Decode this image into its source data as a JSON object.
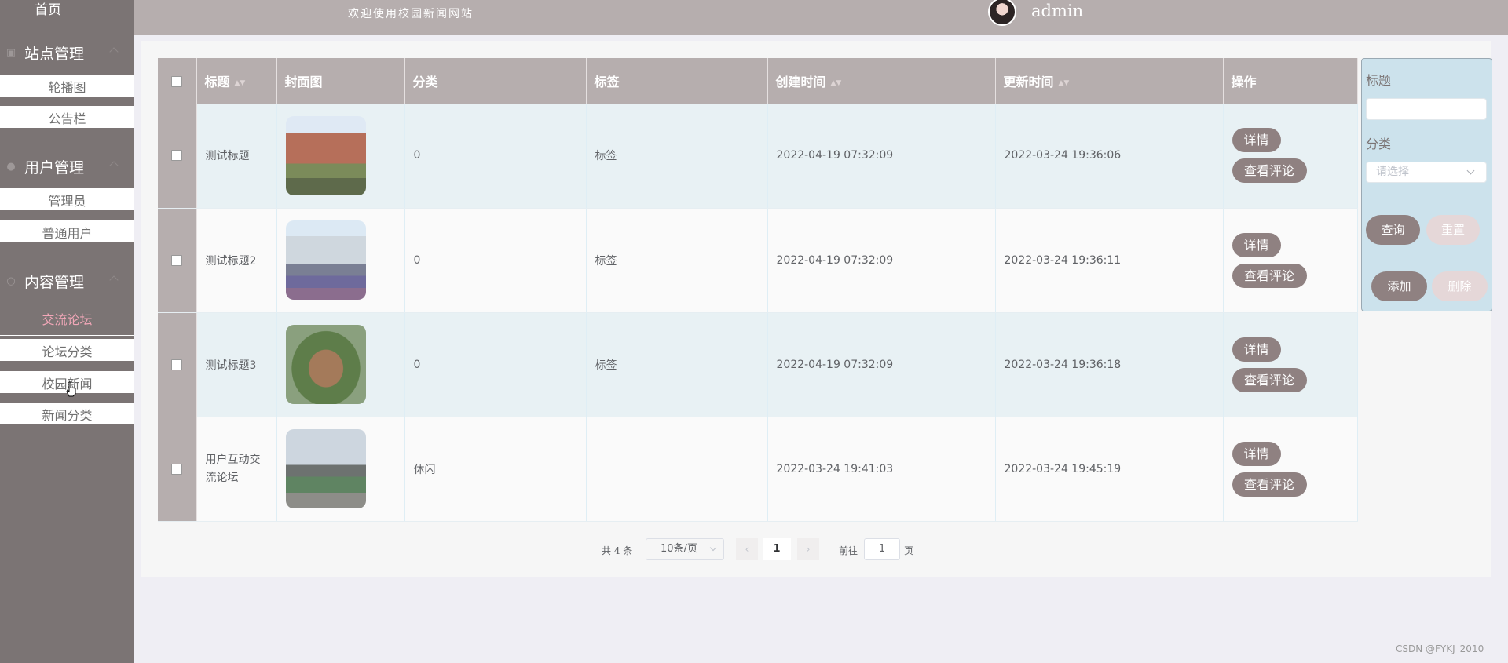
{
  "sidebar": {
    "home": "首页",
    "groups": [
      {
        "label": "站点管理",
        "items": [
          "轮播图",
          "公告栏"
        ]
      },
      {
        "label": "用户管理",
        "items": [
          "管理员",
          "普通用户"
        ]
      },
      {
        "label": "内容管理",
        "items": [
          "交流论坛",
          "论坛分类",
          "校园新闻",
          "新闻分类"
        ]
      }
    ],
    "active_item": "交流论坛"
  },
  "header": {
    "welcome": "欢迎使用校园新闻网站",
    "username": "admin"
  },
  "table": {
    "columns": [
      "标题",
      "封面图",
      "分类",
      "标签",
      "创建时间",
      "更新时间",
      "操作"
    ],
    "rows": [
      {
        "title": "测试标题",
        "category": "0",
        "tag": "标签",
        "created": "2022-04-19 07:32:09",
        "updated": "2022-03-24 19:36:06"
      },
      {
        "title": "测试标题2",
        "category": "0",
        "tag": "标签",
        "created": "2022-04-19 07:32:09",
        "updated": "2022-03-24 19:36:11"
      },
      {
        "title": "测试标题3",
        "category": "0",
        "tag": "标签",
        "created": "2022-04-19 07:32:09",
        "updated": "2022-03-24 19:36:18"
      },
      {
        "title": "用户互动交流论坛",
        "category": "休闲",
        "tag": "",
        "created": "2022-03-24 19:41:03",
        "updated": "2022-03-24 19:45:19"
      }
    ],
    "actions": {
      "detail": "详情",
      "comments": "查看评论"
    }
  },
  "pagination": {
    "total": "共 4 条",
    "page_size": "10条/页",
    "prev": "‹",
    "current": "1",
    "next": "›",
    "goto": "前往",
    "goto_value": "1",
    "page_suffix": "页"
  },
  "search": {
    "title_label": "标题",
    "category_label": "分类",
    "category_placeholder": "请选择",
    "query": "查询",
    "reset": "重置",
    "add": "添加",
    "delete": "删除"
  },
  "watermark": "CSDN @FYKJ_2010",
  "colors": {
    "sidebar_bg": "#7b7474",
    "header_bg": "#b6aeae",
    "button": "#8f8181",
    "active_text": "#f2a7b8",
    "search_panel": "#cce2ec"
  }
}
